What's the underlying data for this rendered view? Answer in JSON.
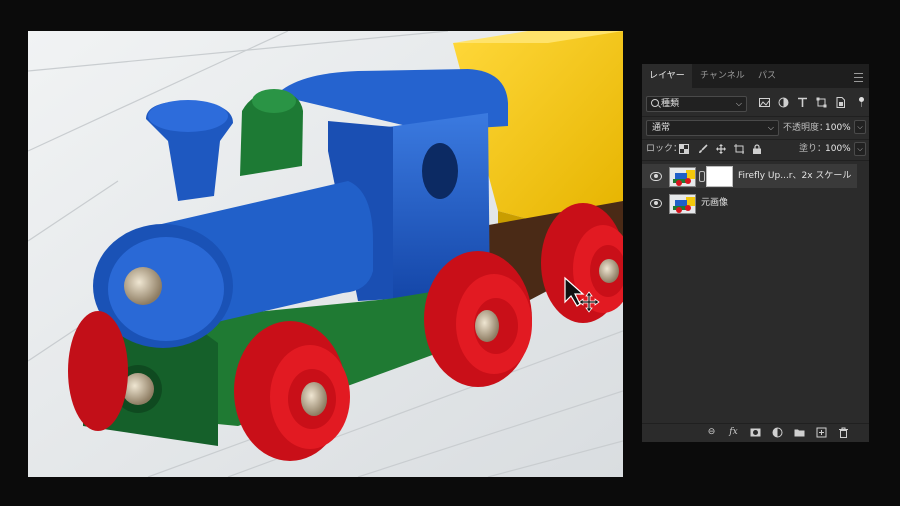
{
  "panel": {
    "tabs": [
      {
        "label": "レイヤー"
      },
      {
        "label": "チャンネル"
      },
      {
        "label": "パス"
      }
    ],
    "filter": {
      "kind_label": "種類"
    },
    "blend_mode": "通常",
    "opacity_label": "不透明度：",
    "opacity_value": "100%",
    "lock_label": "ロック：",
    "fill_label": "塗り：",
    "fill_value": "100%",
    "layers": [
      {
        "name": "Firefly Up...r、2x スケール",
        "selected": true,
        "has_mask": true
      },
      {
        "name": "元画像",
        "selected": false,
        "has_mask": false
      }
    ]
  },
  "canvas": {
    "subject": "wooden toy train",
    "colors": {
      "blue": "#1f5fc8",
      "red": "#d8141e",
      "green": "#1f7a33",
      "yellow": "#f3c80c",
      "brown": "#4a2a16",
      "floor": "#e4e7ea"
    }
  },
  "cursor": {
    "icon": "move-tool-cursor-icon"
  }
}
